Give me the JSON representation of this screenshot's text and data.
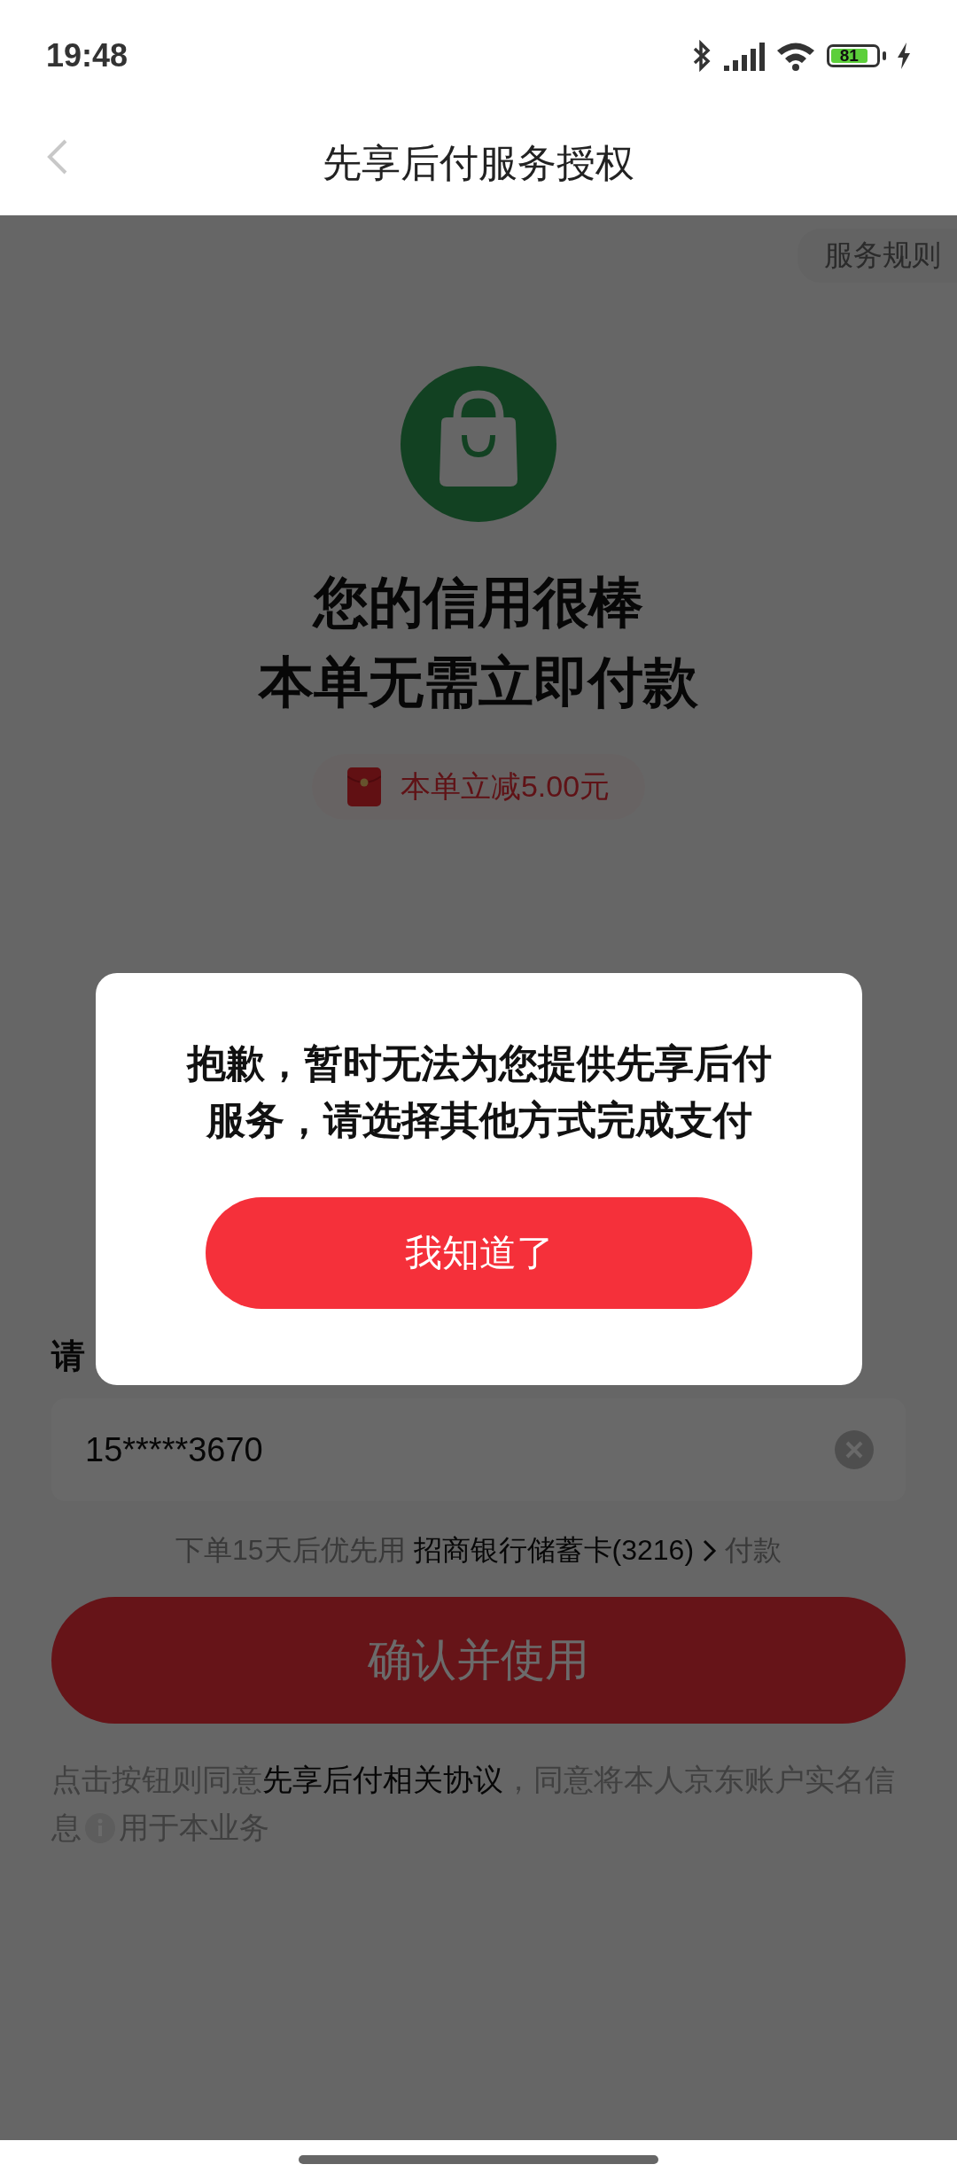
{
  "status_bar": {
    "time": "19:48",
    "battery": "81"
  },
  "header": {
    "title": "先享后付服务授权"
  },
  "rules_link": "服务规则",
  "headline": [
    "您的信用很棒",
    "本单无需立即付款"
  ],
  "discount": "本单立减5.00元",
  "phone_field": {
    "label": "请",
    "value": "15*****3670"
  },
  "payment_note": {
    "prefix": "下单15天后优先用",
    "card": "招商银行储蓄卡(3216)",
    "suffix": "付款"
  },
  "confirm_button": "确认并使用",
  "agreement": {
    "prefix": "点击按钮则同意",
    "link": "先享后付相关协议",
    "middle": "，同意将本人京东账户实名信息",
    "suffix": "用于本业务"
  },
  "dialog": {
    "message": "抱歉，暂时无法为您提供先享后付服务，请选择其他方式完成支付",
    "button": "我知道了"
  }
}
